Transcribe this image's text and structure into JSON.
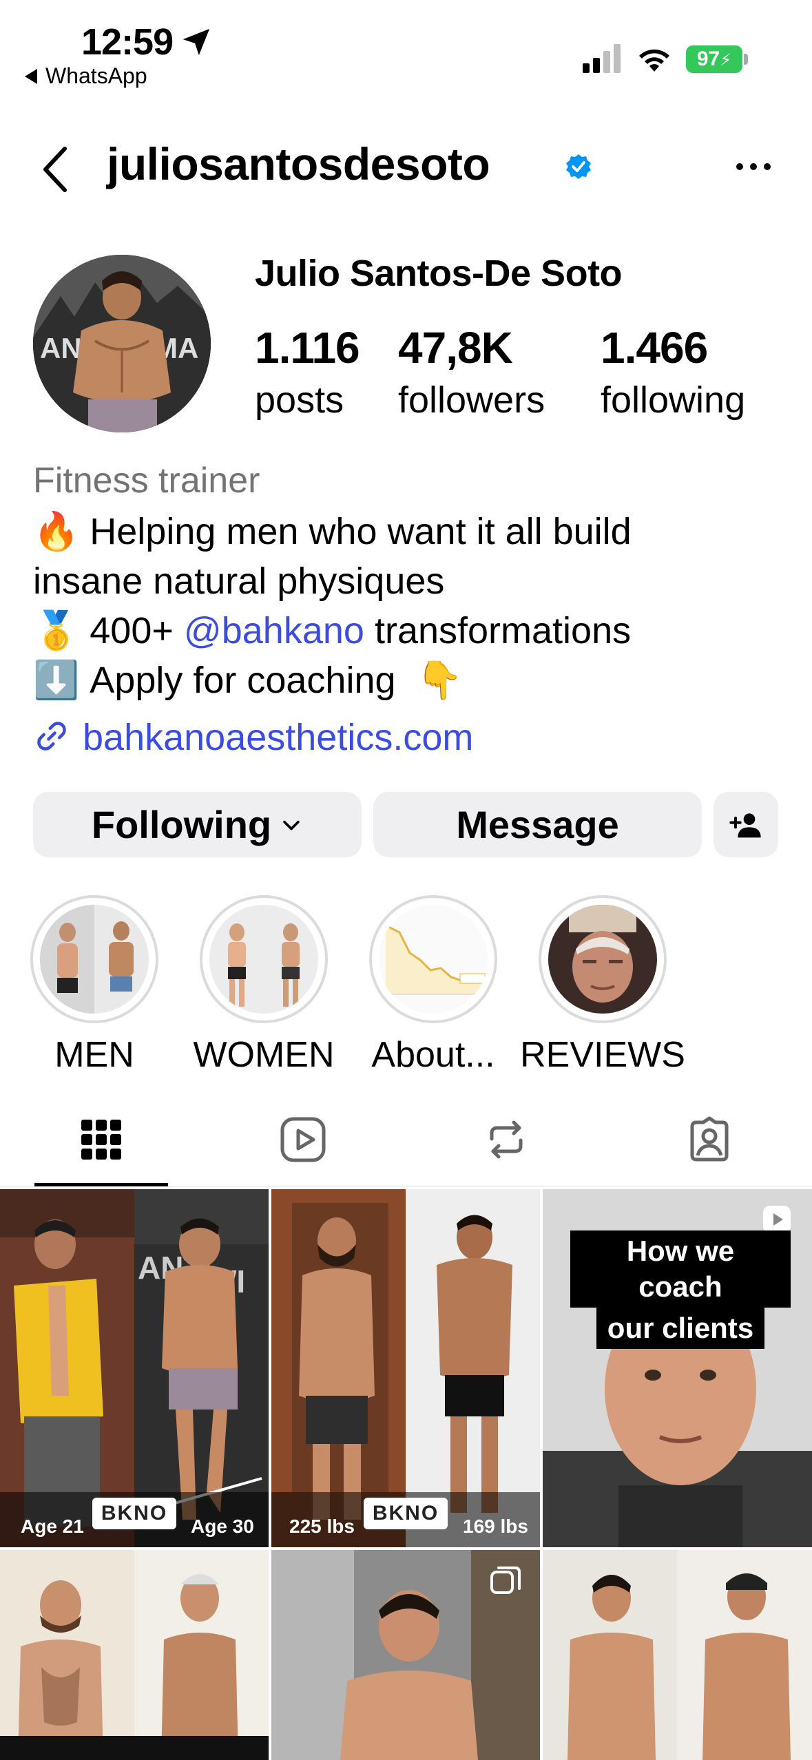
{
  "status_bar": {
    "time": "12:59",
    "back_app": "WhatsApp",
    "battery": "97"
  },
  "header": {
    "username": "juliosantosdesoto",
    "verified": true,
    "more_icon": "more-horizontal-icon"
  },
  "profile": {
    "full_name": "Julio Santos-De Soto",
    "stats": {
      "posts": {
        "value": "1.116",
        "label": "posts"
      },
      "followers": {
        "value": "47,8K",
        "label": "followers"
      },
      "following": {
        "value": "1.466",
        "label": "following"
      }
    },
    "category": "Fitness trainer",
    "bio": {
      "line1_emoji": "🔥",
      "line1_text": "Helping men who want it all build",
      "line2_text": "insane natural physiques",
      "line3_emoji": "🥇",
      "line3_pre": "400+",
      "line3_mention": "@bahkano",
      "line3_post": "transformations",
      "line4_emoji": "⬇️",
      "line4_text": "Apply for coaching",
      "line4_emoji_end": "👇"
    },
    "link": "bahkanoaesthetics.com"
  },
  "actions": {
    "following_label": "Following",
    "message_label": "Message"
  },
  "highlights": [
    {
      "label": "MEN"
    },
    {
      "label": "WOMEN"
    },
    {
      "label": "About..."
    },
    {
      "label": "REVIEWS"
    }
  ],
  "tabs": [
    "grid-icon",
    "reels-icon",
    "reposts-icon",
    "tagged-icon"
  ],
  "posts": {
    "p1": {
      "left_caption": "Age 21",
      "right_caption": "Age 30",
      "logo": "BKNO"
    },
    "p2": {
      "left_caption": "225 lbs",
      "right_caption": "169 lbs",
      "logo": "BKNO"
    },
    "p3": {
      "caption_line1": "How we coach",
      "caption_line2": "our clients"
    }
  },
  "colors": {
    "link": "#3b4ce0",
    "verified": "#0095f6",
    "button_bg": "#efeff2",
    "battery": "#34c759"
  }
}
